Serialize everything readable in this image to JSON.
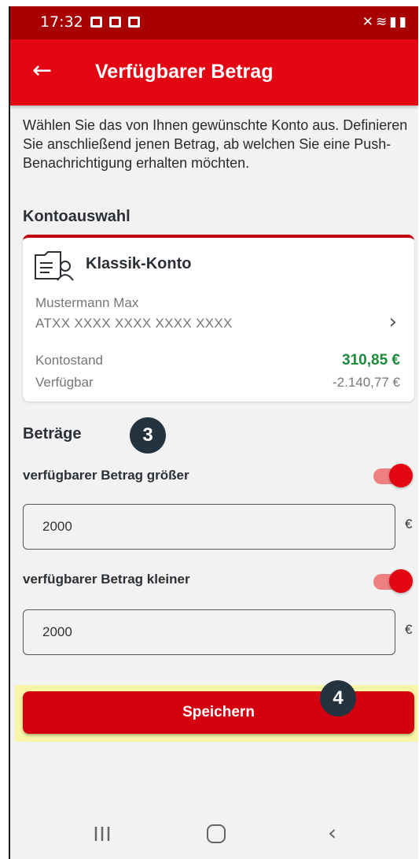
{
  "status_bar": {
    "time": "17:32",
    "icons": [
      "image-icon",
      "message-icon",
      "check-icon",
      "mute-icon",
      "wifi-icon",
      "signal-icon",
      "battery-icon"
    ]
  },
  "app_bar": {
    "back_icon": "arrow-left-icon",
    "title": "Verfügbarer Betrag"
  },
  "intro_text": "Wählen Sie das von Ihnen gewünschte Konto aus. Definieren Sie anschließend jenen Betrag, ab welchen Sie eine Push-Benachrichtigung erhalten möchten.",
  "account_section": {
    "title": "Kontoauswahl",
    "account": {
      "name": "Klassik-Konto",
      "owner": "Mustermann Max",
      "iban": "ATXX XXXX XXXX XXXX XXXX",
      "balance_label": "Kontostand",
      "balance_value": "310,85 €",
      "available_label": "Verfügbar",
      "available_value": "-2.140,77 €"
    }
  },
  "amounts_section": {
    "title": "Beträge",
    "badge": "3",
    "greater": {
      "label": "verfügbarer Betrag größer",
      "enabled": true,
      "value": "2000",
      "currency": "€"
    },
    "less": {
      "label": "verfügbarer Betrag kleiner",
      "enabled": true,
      "value": "2000",
      "currency": "€"
    }
  },
  "save": {
    "label": "Speichern",
    "badge": "4"
  },
  "colors": {
    "primary": "#e30613",
    "status_bar": "#a80000",
    "positive": "#1c8a3a",
    "highlight": "#f8f5a8",
    "badge": "#23333f"
  }
}
